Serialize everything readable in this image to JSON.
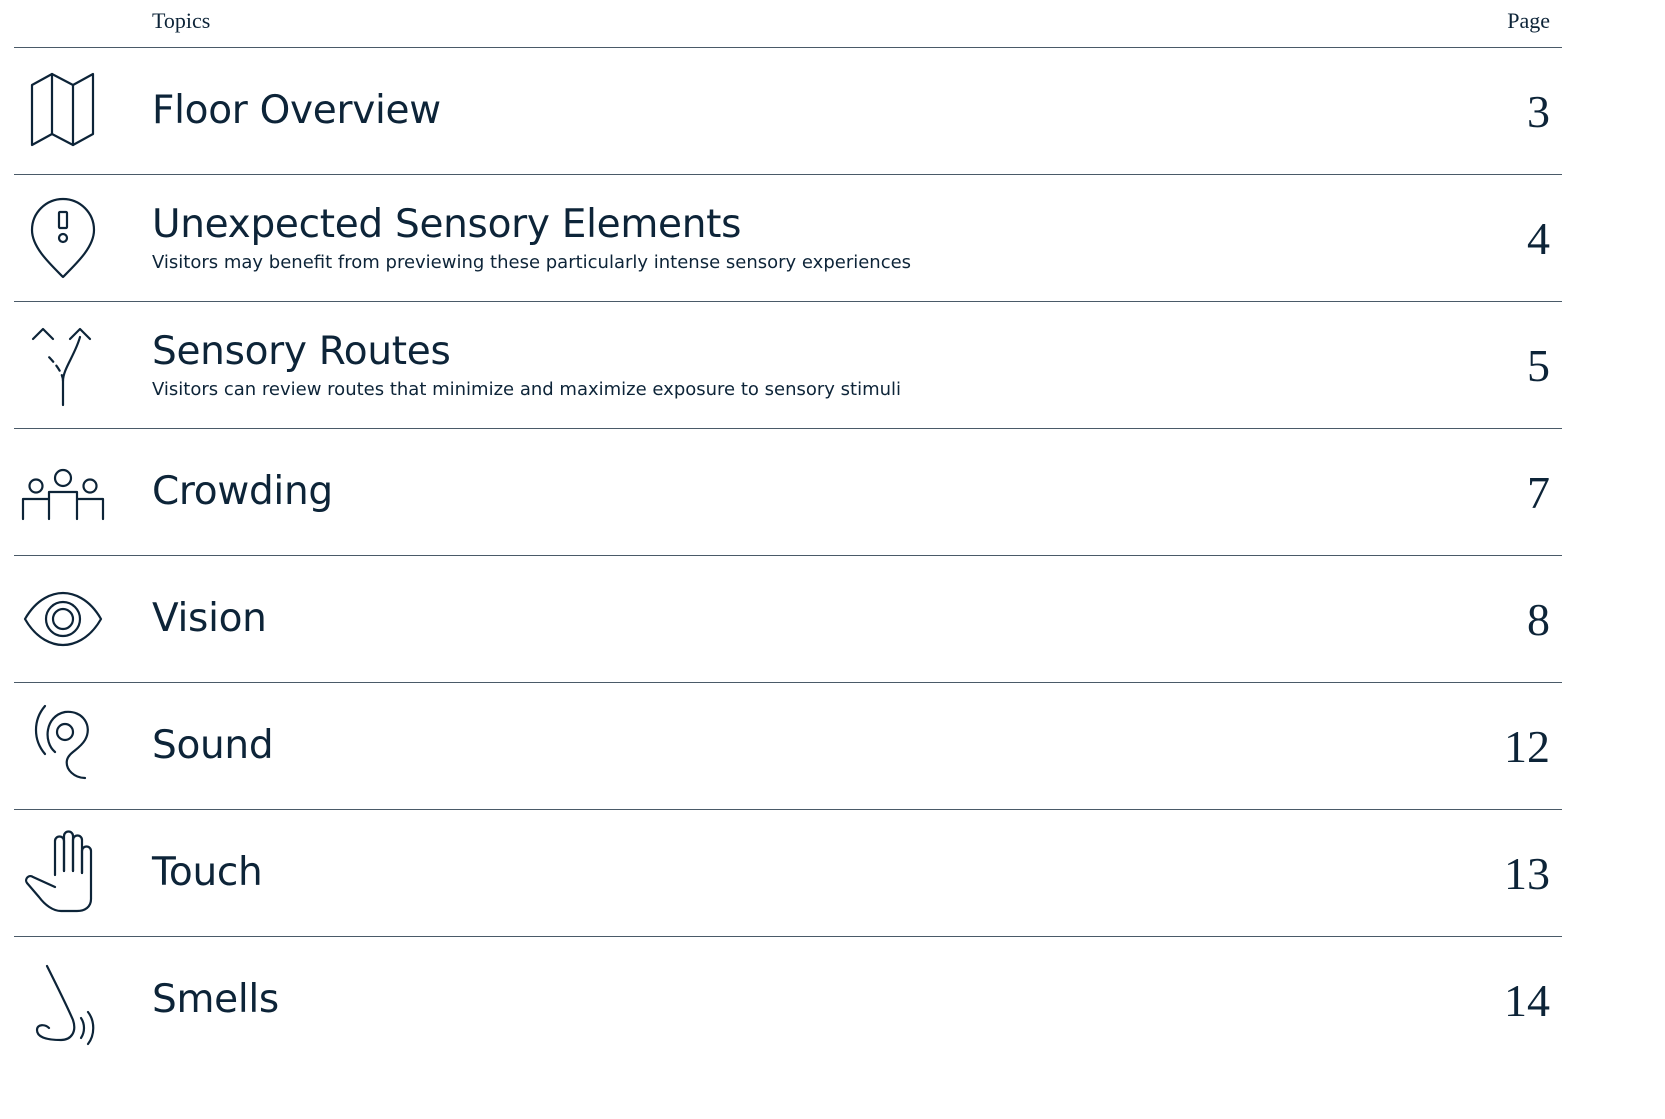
{
  "header": {
    "topics_label": "Topics",
    "page_label": "Page"
  },
  "rows": [
    {
      "icon": "map-icon",
      "title": "Floor Overview",
      "description": "",
      "page": "3"
    },
    {
      "icon": "alert-pin-icon",
      "title": "Unexpected Sensory Elements",
      "description": "Visitors may benefit from previewing these particularly intense sensory experiences",
      "page": "4"
    },
    {
      "icon": "route-split-icon",
      "title": "Sensory Routes",
      "description": "Visitors can review routes that minimize and maximize exposure to sensory stimuli",
      "page": "5"
    },
    {
      "icon": "crowd-icon",
      "title": "Crowding",
      "description": "",
      "page": "7"
    },
    {
      "icon": "eye-icon",
      "title": "Vision",
      "description": "",
      "page": "8"
    },
    {
      "icon": "ear-icon",
      "title": "Sound",
      "description": "",
      "page": "12"
    },
    {
      "icon": "hand-icon",
      "title": "Touch",
      "description": "",
      "page": "13"
    },
    {
      "icon": "nose-icon",
      "title": "Smells",
      "description": "",
      "page": "14"
    }
  ],
  "colors": {
    "text": "#0d2438",
    "divider": "#4a5a68",
    "background": "#ffffff"
  }
}
